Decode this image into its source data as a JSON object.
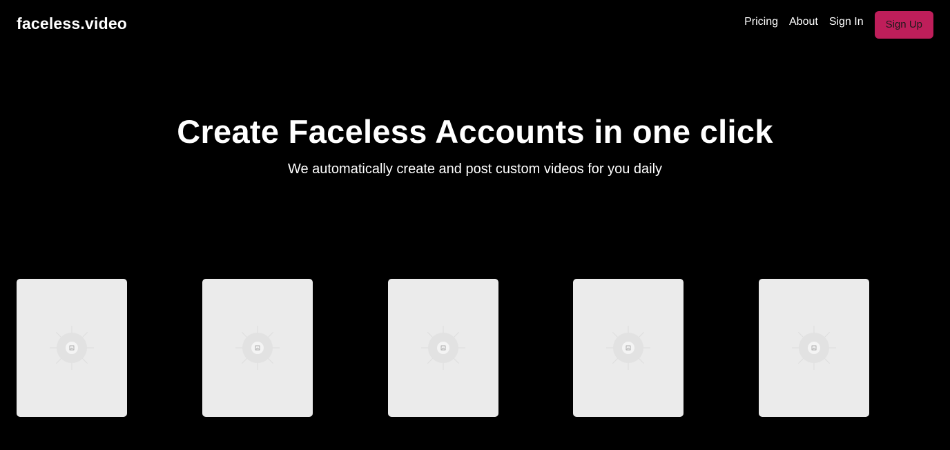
{
  "header": {
    "logo": "faceless.video",
    "nav": {
      "pricing": "Pricing",
      "about": "About",
      "sign_in": "Sign In",
      "sign_up": "Sign Up"
    }
  },
  "hero": {
    "title": "Create Faceless Accounts in one click",
    "subtitle": "We automatically create and post custom videos for you daily"
  },
  "cards": [
    {
      "icon": "image-placeholder-icon"
    },
    {
      "icon": "image-placeholder-icon"
    },
    {
      "icon": "image-placeholder-icon"
    },
    {
      "icon": "image-placeholder-icon"
    },
    {
      "icon": "image-placeholder-icon"
    }
  ],
  "colors": {
    "background": "#000000",
    "accent": "#be1e5a",
    "card": "#ebebeb"
  }
}
